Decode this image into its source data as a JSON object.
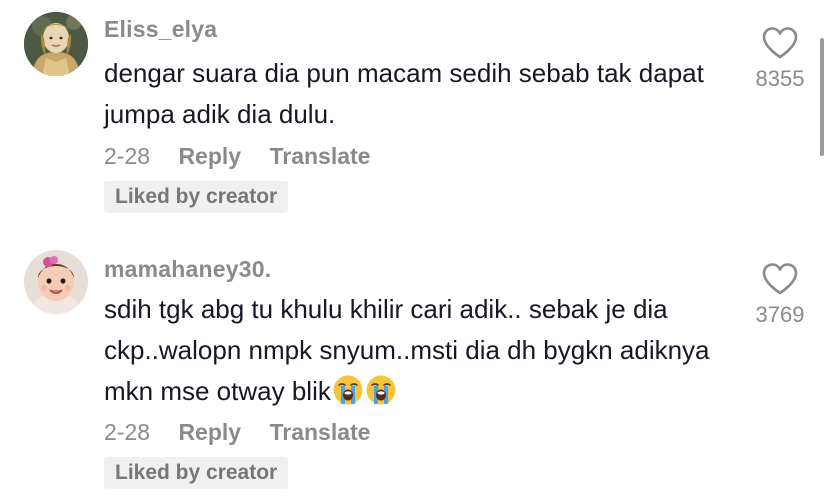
{
  "comments": [
    {
      "username": "Eliss_elya",
      "text": "dengar suara dia pun macam sedih sebab tak dapat jumpa adik dia dulu.",
      "date": "2-28",
      "reply_label": "Reply",
      "translate_label": "Translate",
      "badge": "Liked by creator",
      "like_count": "8355",
      "avatar_icon": "user-avatar-icon"
    },
    {
      "username": "mamahaney30.",
      "text": "sdih tgk abg tu khulu khilir cari adik.. sebak je dia ckp..walopn nmpk snyum..msti dia dh bygkn adiknya mkn mse otway blik",
      "emojis": [
        "loudly-crying-face-icon",
        "loudly-crying-face-icon"
      ],
      "date": "2-28",
      "reply_label": "Reply",
      "translate_label": "Translate",
      "badge": "Liked by creator",
      "like_count": "3769",
      "avatar_icon": "user-avatar-icon"
    }
  ],
  "colors": {
    "text": "#161823",
    "secondary": "#8a8a8a",
    "badge_bg": "#f0f0f0"
  },
  "icons": {
    "like": "heart-outline-icon"
  }
}
